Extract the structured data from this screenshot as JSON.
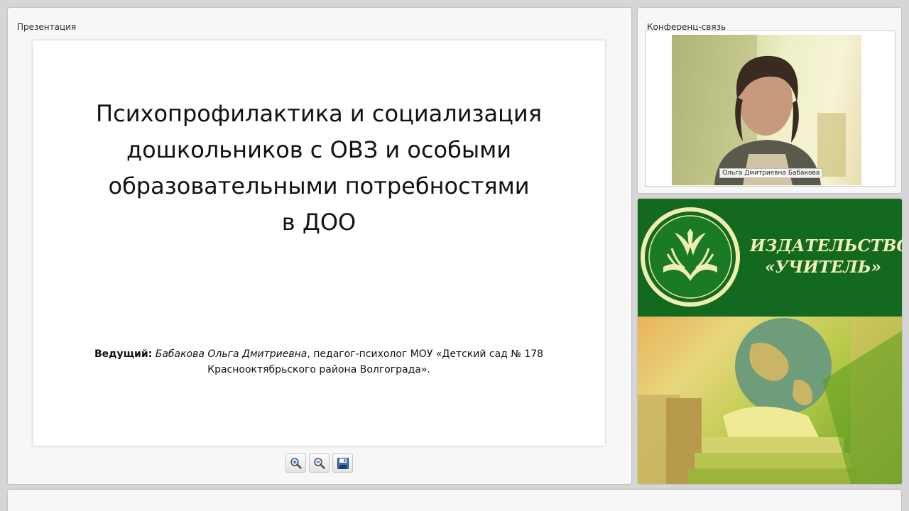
{
  "presentation_panel": {
    "title": "Презентация",
    "slide": {
      "title_lines": [
        "Психопрофилактика и социализация",
        "дошкольников с ОВЗ и особыми",
        "образовательными потребностями",
        "в ДОО"
      ],
      "presenter_label": "Ведущий:",
      "presenter_name": "Бабакова Ольга Дмитриевна",
      "presenter_details_line1": ", педагог-психолог МОУ «Детский сад № 178",
      "presenter_details_line2": "Краснооктябрьского района Волгограда»."
    },
    "toolbar": {
      "zoom_in_icon": "magnifier-plus-icon",
      "zoom_out_icon": "magnifier-minus-icon",
      "save_icon": "floppy-disk-icon"
    }
  },
  "conference_panel": {
    "title": "Конференц-связь",
    "participant_name": "Ольга Дмитриевна Бабакова"
  },
  "ad_banner": {
    "line1": "ИЗДАТЕЛЬСТВО",
    "line2": "«УЧИТЕЛЬ»",
    "colors": {
      "green": "#13691f",
      "lettering": "#f1f0b8"
    }
  }
}
